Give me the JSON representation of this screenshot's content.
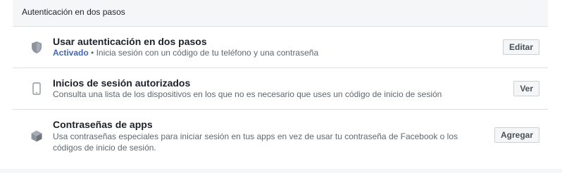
{
  "section": {
    "title": "Autenticación en dos pasos"
  },
  "rows": [
    {
      "title": "Usar autenticación en dos pasos",
      "status": "Activado",
      "separator": "•",
      "description": "Inicia sesión con un código de tu teléfono y una contraseña",
      "button": "Editar",
      "icon": "shield-icon"
    },
    {
      "title": "Inicios de sesión autorizados",
      "description": "Consulta una lista de los dispositivos en los que no es necesario que uses un código de inicio de sesión",
      "button": "Ver",
      "icon": "phone-icon"
    },
    {
      "title": "Contraseñas de apps",
      "description": "Usa contraseñas especiales para iniciar sesión en tus apps en vez de usar tu contraseña de Facebook o los códigos de inicio de sesión.",
      "button": "Agregar",
      "icon": "cube-icon"
    }
  ],
  "colors": {
    "status": "#4267b2",
    "header_bg": "#f5f6f7",
    "divider": "#dddfe2"
  }
}
